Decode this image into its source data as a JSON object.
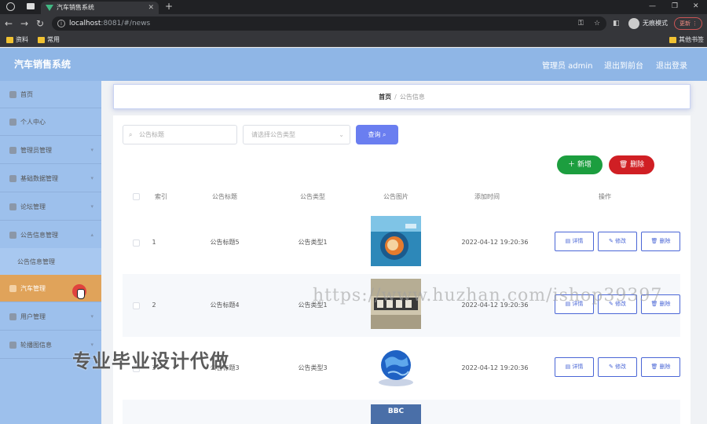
{
  "browser": {
    "tab_title": "汽车销售系统",
    "url_host": "localhost",
    "url_rest": ":8081/#/news",
    "incognito_label": "无痕模式",
    "update_label": "更新",
    "bookmarks": [
      "资料",
      "常用"
    ],
    "other_bookmarks": "其他书签"
  },
  "app": {
    "title": "汽车销售系统",
    "user": "管理员 admin",
    "back_front": "退出到前台",
    "logout": "退出登录",
    "accent": "#8fb6e6"
  },
  "sidebar": {
    "items": [
      {
        "label": "首页",
        "icon": "home-icon"
      },
      {
        "label": "个人中心",
        "icon": "user-icon"
      },
      {
        "label": "管理员管理",
        "icon": "admin-icon"
      },
      {
        "label": "基础数据管理",
        "icon": "database-icon"
      },
      {
        "label": "论坛管理",
        "icon": "forum-icon"
      },
      {
        "label": "公告信息管理",
        "icon": "notice-icon"
      },
      {
        "label": "公告信息管理",
        "icon": ""
      },
      {
        "label": "汽车管理",
        "icon": "car-icon"
      },
      {
        "label": "用户管理",
        "icon": "users-icon"
      },
      {
        "label": "轮播图信息",
        "icon": "carousel-icon"
      }
    ]
  },
  "breadcrumb": {
    "home": "首页",
    "sep": "/",
    "current": "公告信息"
  },
  "search": {
    "title_placeholder": "公告标题",
    "type_placeholder": "请选择公告类型",
    "query_label": "查询"
  },
  "actions": {
    "add_label": "新增",
    "delete_label": "删除"
  },
  "table": {
    "headers": [
      "索引",
      "公告标题",
      "公告类型",
      "公告图片",
      "添加时间",
      "操作"
    ],
    "rows": [
      {
        "index": "1",
        "title": "公告标题5",
        "type": "公告类型1",
        "time": "2022-04-12 19:20:36"
      },
      {
        "index": "2",
        "title": "公告标题4",
        "type": "公告类型1",
        "time": "2022-04-12 19:20:36"
      },
      {
        "index": "3",
        "title": "公告标题3",
        "type": "公告类型3",
        "time": "2022-04-12 19:20:36"
      }
    ],
    "row_actions": {
      "detail": "详情",
      "edit": "修改",
      "delete": "删除"
    },
    "next_thumb_text": "BBC"
  },
  "watermarks": {
    "url": "https://www.huzhan.com/ishop39397",
    "text": "专业毕业设计代做"
  }
}
